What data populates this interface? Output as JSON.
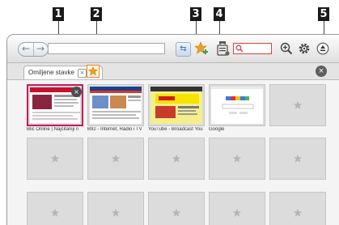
{
  "callouts": [
    "1",
    "2",
    "3",
    "4",
    "5"
  ],
  "toolbar": {
    "back_glyph": "←",
    "forward_glyph": "→",
    "url_value": "",
    "refresh_glyph": "⇆",
    "search_value": ""
  },
  "tabs": {
    "active_label": "Omiljene stavke",
    "close_glyph": "×",
    "close_all_glyph": "×"
  },
  "speed_dial": {
    "tile_close_glyph": "×",
    "tiles": [
      {
        "label": "Blic Online | Najčitaniji n",
        "thumb": "blic"
      },
      {
        "label": "B92 - Internet, Radio i TV",
        "thumb": "b92"
      },
      {
        "label": "YouTube - Broadcast You",
        "thumb": "youtube"
      },
      {
        "label": "Google",
        "thumb": "google"
      }
    ]
  },
  "colors": {
    "selection": "#c8175b",
    "favorite_star": "#f0a020",
    "search_border": "#d04545"
  },
  "icons": {
    "add_favorite": "star-plus-icon",
    "favorites_list": "bookmark-list-icon",
    "search": "search-icon",
    "zoom": "zoom-in-icon",
    "settings": "gear-icon",
    "menu": "scroll-up-icon",
    "placeholder": "star-placeholder-icon"
  }
}
